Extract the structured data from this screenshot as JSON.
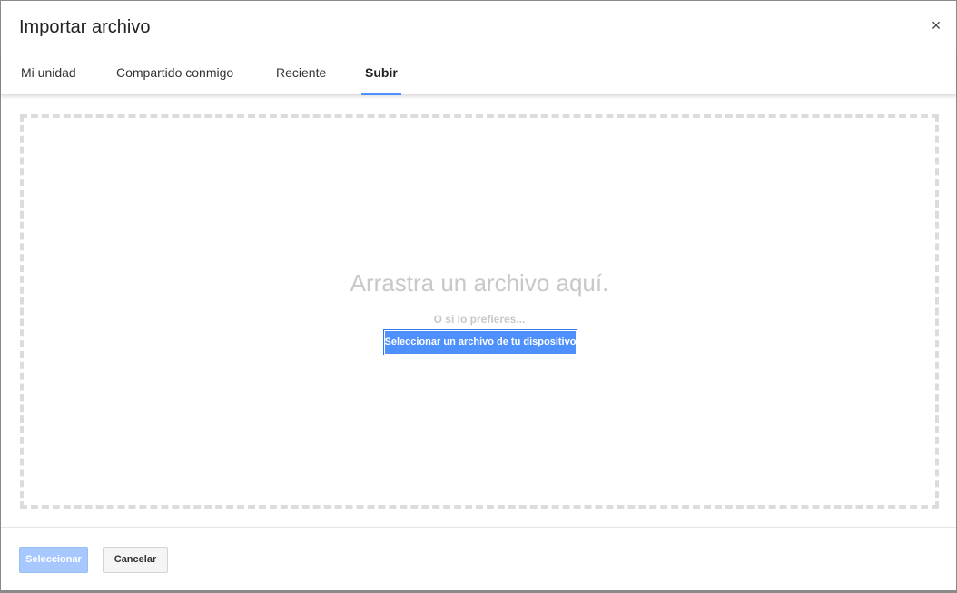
{
  "dialog": {
    "title": "Importar archivo",
    "close_label": "×"
  },
  "tabs": [
    {
      "label": "Mi unidad",
      "active": false
    },
    {
      "label": "Compartido conmigo",
      "active": false
    },
    {
      "label": "Reciente",
      "active": false
    },
    {
      "label": "Subir",
      "active": true
    }
  ],
  "upload": {
    "drop_text": "Arrastra un archivo aquí.",
    "or_text": "O si lo prefieres...",
    "select_device_label": "Seleccionar un archivo de tu dispositivo"
  },
  "footer": {
    "select_label": "Seleccionar",
    "select_enabled": false,
    "cancel_label": "Cancelar"
  },
  "colors": {
    "accent": "#4d90fe",
    "disabled_primary": "#a6c8ff",
    "dropzone_border": "#dcdcdc"
  }
}
